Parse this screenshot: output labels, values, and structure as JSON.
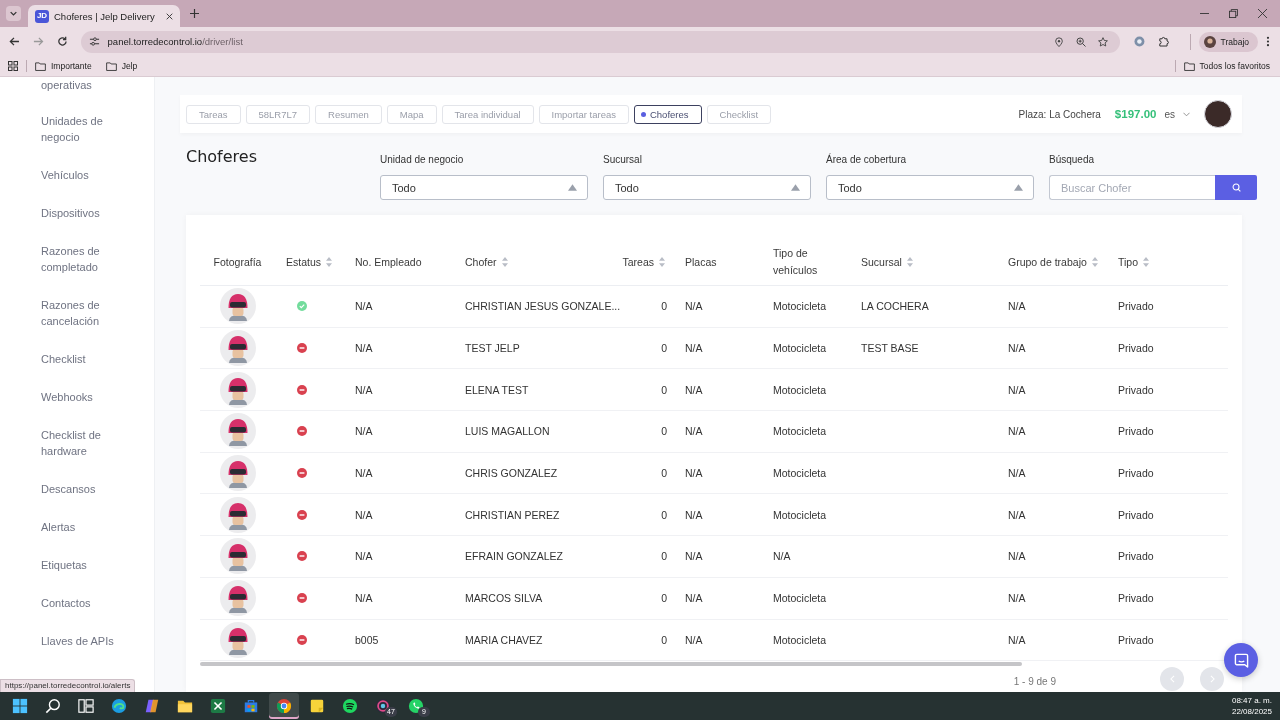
{
  "browser": {
    "tab": {
      "favicon": "JD",
      "title": "Choferes | Jelp Delivery"
    },
    "url": {
      "host": "panel.torredecontrol.io",
      "path": "/driver/list"
    },
    "profile": "Trabajo",
    "bookmarks": [
      {
        "label": "Importante"
      },
      {
        "label": "Jelp"
      }
    ],
    "all_bookmarks": "Todos los favoritos"
  },
  "sidebar": {
    "items": [
      "operativas",
      "Unidades de negocio",
      "Vehículos",
      "Dispositivos",
      "Razones de completado",
      "Razones de cancelación",
      "Checklist",
      "Webhooks",
      "Checklist de hardware",
      "Descansos",
      "Alertas",
      "Etiquetas",
      "Contactos",
      "Llaves de APIs"
    ]
  },
  "top_nav": {
    "tabs": [
      {
        "label": "Tareas",
        "selected": false
      },
      {
        "label": "58LR7L7",
        "selected": false
      },
      {
        "label": "Resumen",
        "selected": false
      },
      {
        "label": "Mapa",
        "selected": false
      },
      {
        "label": "Tarea individual",
        "selected": false
      },
      {
        "label": "Importar tareas",
        "selected": false
      },
      {
        "label": "Choferes",
        "selected": true
      },
      {
        "label": "Checklist",
        "selected": false
      }
    ]
  },
  "account": {
    "plaza": "Plaza: La Cochera",
    "balance": "$197.00",
    "language": "es"
  },
  "page_title": "Choferes",
  "filters": [
    {
      "label": "Unidad de negocio",
      "value": "Todo"
    },
    {
      "label": "Sucursal",
      "value": "Todo"
    },
    {
      "label": "Área de cobertura",
      "value": "Todo"
    }
  ],
  "search": {
    "label": "Búsqueda",
    "placeholder": "Buscar Chofer"
  },
  "table": {
    "columns": [
      {
        "label": "Fotografía",
        "sortable": false
      },
      {
        "label": "Estatus",
        "sortable": true
      },
      {
        "label": "No. Empleado",
        "sortable": false
      },
      {
        "label": "Chofer",
        "sortable": true
      },
      {
        "label": "Tareas",
        "sortable": true
      },
      {
        "label": "Placas",
        "sortable": false
      },
      {
        "label": "Tipo de vehículos",
        "sortable": false
      },
      {
        "label": "Sucursal",
        "sortable": true
      },
      {
        "label": "Grupo de trabajo",
        "sortable": true
      },
      {
        "label": "Tipo",
        "sortable": true
      }
    ],
    "rows": [
      {
        "active": true,
        "employee_no": "N/A",
        "driver": "CHRISTIAN JESUS GONZALE...",
        "tasks": "0",
        "plates": "N/A",
        "vehicle_type": "Motocicleta",
        "branch": "LA COCHERA",
        "work_group": "N/A",
        "type": "Privado"
      },
      {
        "active": false,
        "employee_no": "N/A",
        "driver": "TEST JELP",
        "tasks": "0",
        "plates": "N/A",
        "vehicle_type": "Motocicleta",
        "branch": "TEST BASE",
        "work_group": "N/A",
        "type": "Privado"
      },
      {
        "active": false,
        "employee_no": "N/A",
        "driver": "ELENA TEST",
        "tasks": "0",
        "plates": "N/A",
        "vehicle_type": "Motocicleta",
        "work_group": "N/A",
        "type": "Privado"
      },
      {
        "active": false,
        "employee_no": "N/A",
        "driver": "LUIS MAGALLON",
        "tasks": "0",
        "plates": "N/A",
        "vehicle_type": "Motocicleta",
        "work_group": "N/A",
        "type": "Privado"
      },
      {
        "active": false,
        "employee_no": "N/A",
        "driver": "CHRIS GONZALEZ",
        "tasks": "0",
        "plates": "N/A",
        "vehicle_type": "Motocicleta",
        "work_group": "N/A",
        "type": "Privado"
      },
      {
        "active": false,
        "employee_no": "N/A",
        "driver": "CHRISTIAN PEREZ",
        "tasks": "0",
        "plates": "N/A",
        "vehicle_type": "Motocicleta",
        "work_group": "N/A",
        "type": "Privado"
      },
      {
        "active": false,
        "employee_no": "N/A",
        "driver": "EFRAIN GONZALEZ",
        "tasks": "0",
        "plates": "N/A",
        "vehicle_type": "N/A",
        "work_group": "N/A",
        "type": "Privado"
      },
      {
        "active": false,
        "employee_no": "N/A",
        "driver": "MARCOS SILVA",
        "tasks": "0",
        "plates": "N/A",
        "vehicle_type": "Motocicleta",
        "work_group": "N/A",
        "type": "Privado"
      },
      {
        "active": false,
        "employee_no": "b005",
        "driver": "MARIA CHAVEZ",
        "tasks": "0",
        "plates": "N/A",
        "vehicle_type": "Motocicleta",
        "work_group": "N/A",
        "type": "Privado"
      }
    ]
  },
  "pagination": {
    "text": "1 - 9 de 9",
    "buttons": [
      {
        "kind": "previous",
        "disabled": true
      },
      {
        "kind": "next",
        "disabled": true
      }
    ]
  },
  "status_url": "https://panel.torredecontrol.io/alerts",
  "taskbar": {
    "apps": [
      {
        "kind": "start",
        "selected": false
      },
      {
        "kind": "search",
        "selected": false
      },
      {
        "kind": "taskview",
        "selected": false
      },
      {
        "kind": "edge",
        "selected": false
      },
      {
        "kind": "copilot",
        "selected": false
      },
      {
        "kind": "explorer",
        "selected": false
      },
      {
        "kind": "excel",
        "selected": false
      },
      {
        "kind": "store",
        "selected": false
      },
      {
        "kind": "chrome",
        "selected": true
      },
      {
        "kind": "notes",
        "selected": false
      },
      {
        "kind": "spotify",
        "selected": false
      },
      {
        "kind": "ring",
        "selected": false,
        "badge": "47"
      },
      {
        "kind": "whatsapp",
        "selected": false,
        "badge": "9"
      }
    ],
    "time": "08:47 a. m.",
    "date": "22/08/2025"
  }
}
